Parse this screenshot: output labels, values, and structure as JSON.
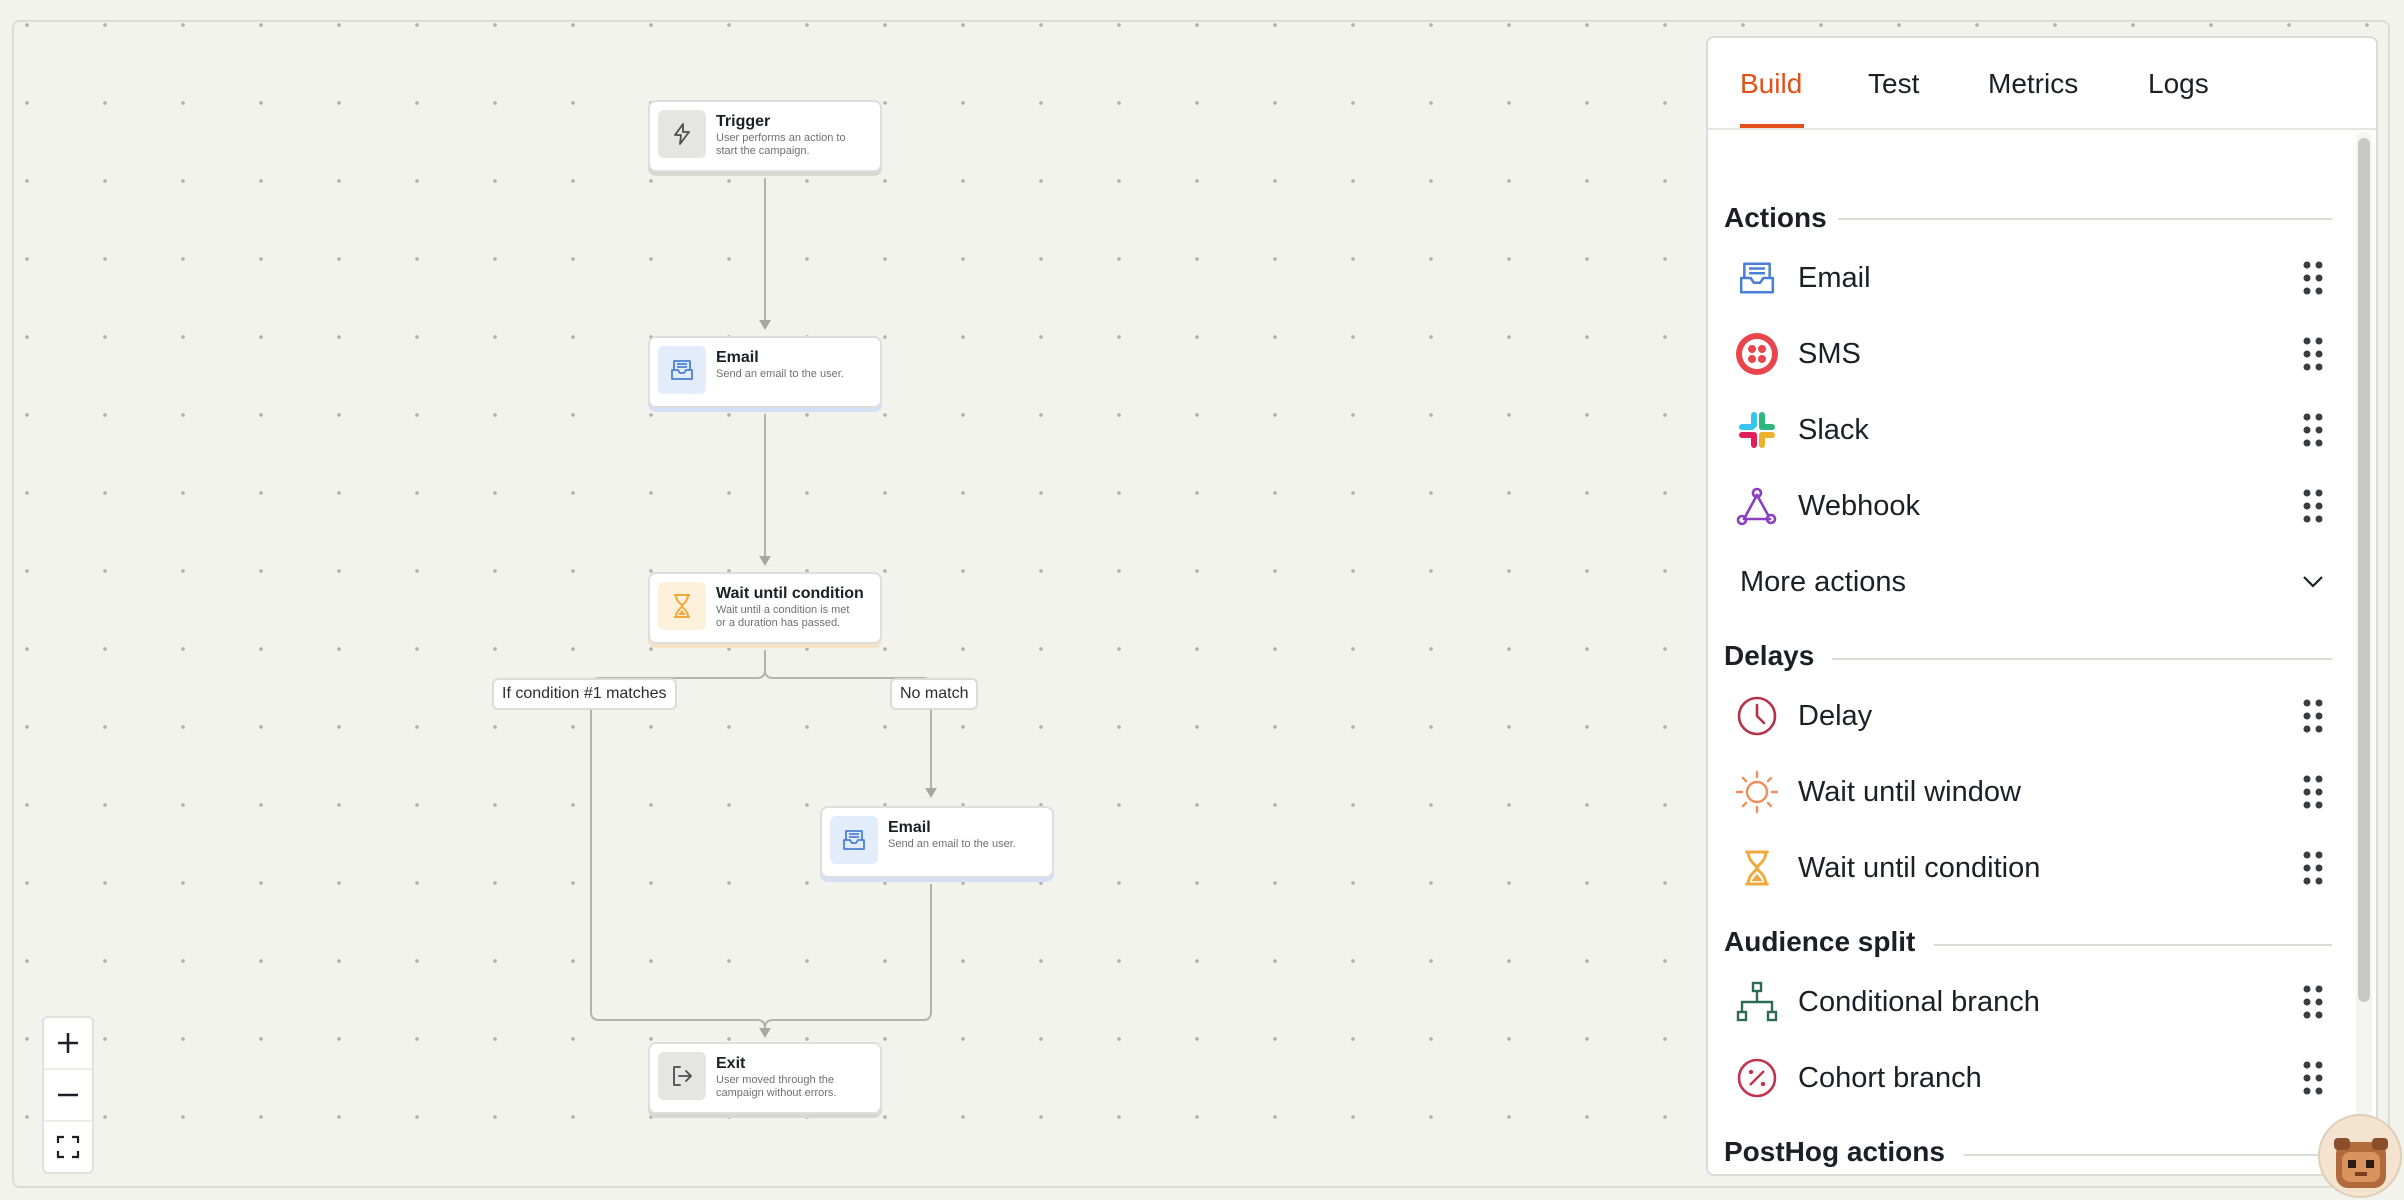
{
  "canvas": {
    "nodes": [
      {
        "id": "trigger",
        "title": "Trigger",
        "desc": [
          "User performs an action to",
          "start the campaign."
        ],
        "icon": "lightning-icon"
      },
      {
        "id": "email1",
        "title": "Email",
        "desc": [
          "Send an email to the user."
        ],
        "icon": "inbox-icon"
      },
      {
        "id": "wait",
        "title": "Wait until condition",
        "desc": [
          "Wait until a condition is met",
          "or a duration has passed."
        ],
        "icon": "hourglass-icon"
      },
      {
        "id": "email2",
        "title": "Email",
        "desc": [
          "Send an email to the user."
        ],
        "icon": "inbox-icon"
      },
      {
        "id": "exit",
        "title": "Exit",
        "desc": [
          "User moved through the",
          "campaign without errors."
        ],
        "icon": "exit-icon"
      }
    ],
    "branch_labels": {
      "match": "If condition #1 matches",
      "no_match": "No match"
    },
    "zoom_controls": [
      "zoom-in",
      "zoom-out",
      "fit-view"
    ]
  },
  "panel": {
    "tabs": [
      {
        "label": "Build",
        "active": true
      },
      {
        "label": "Test"
      },
      {
        "label": "Metrics"
      },
      {
        "label": "Logs"
      }
    ],
    "sections": {
      "actions": {
        "title": "Actions",
        "items": [
          {
            "label": "Email",
            "icon": "inbox-icon"
          },
          {
            "label": "SMS",
            "icon": "twilio-icon"
          },
          {
            "label": "Slack",
            "icon": "slack-icon"
          },
          {
            "label": "Webhook",
            "icon": "webhook-icon"
          }
        ],
        "more": "More actions"
      },
      "delays": {
        "title": "Delays",
        "items": [
          {
            "label": "Delay",
            "icon": "clock-icon"
          },
          {
            "label": "Wait until window",
            "icon": "sun-icon"
          },
          {
            "label": "Wait until condition",
            "icon": "hourglass-icon"
          }
        ]
      },
      "audience": {
        "title": "Audience split",
        "items": [
          {
            "label": "Conditional branch",
            "icon": "branch-icon"
          },
          {
            "label": "Cohort branch",
            "icon": "percent-icon"
          }
        ]
      },
      "posthog": {
        "title": "PostHog actions"
      }
    }
  },
  "colors": {
    "accent": "#e3501a",
    "email_blue": "#4a7fd6",
    "wait_orange": "#f2a93b",
    "sms_red": "#e8464c",
    "webhook_purple": "#8a3fbf",
    "delay_red": "#b4334a",
    "sun_orange": "#f28c5a",
    "branch_green": "#2e6b54",
    "cohort_red": "#c2344d"
  }
}
